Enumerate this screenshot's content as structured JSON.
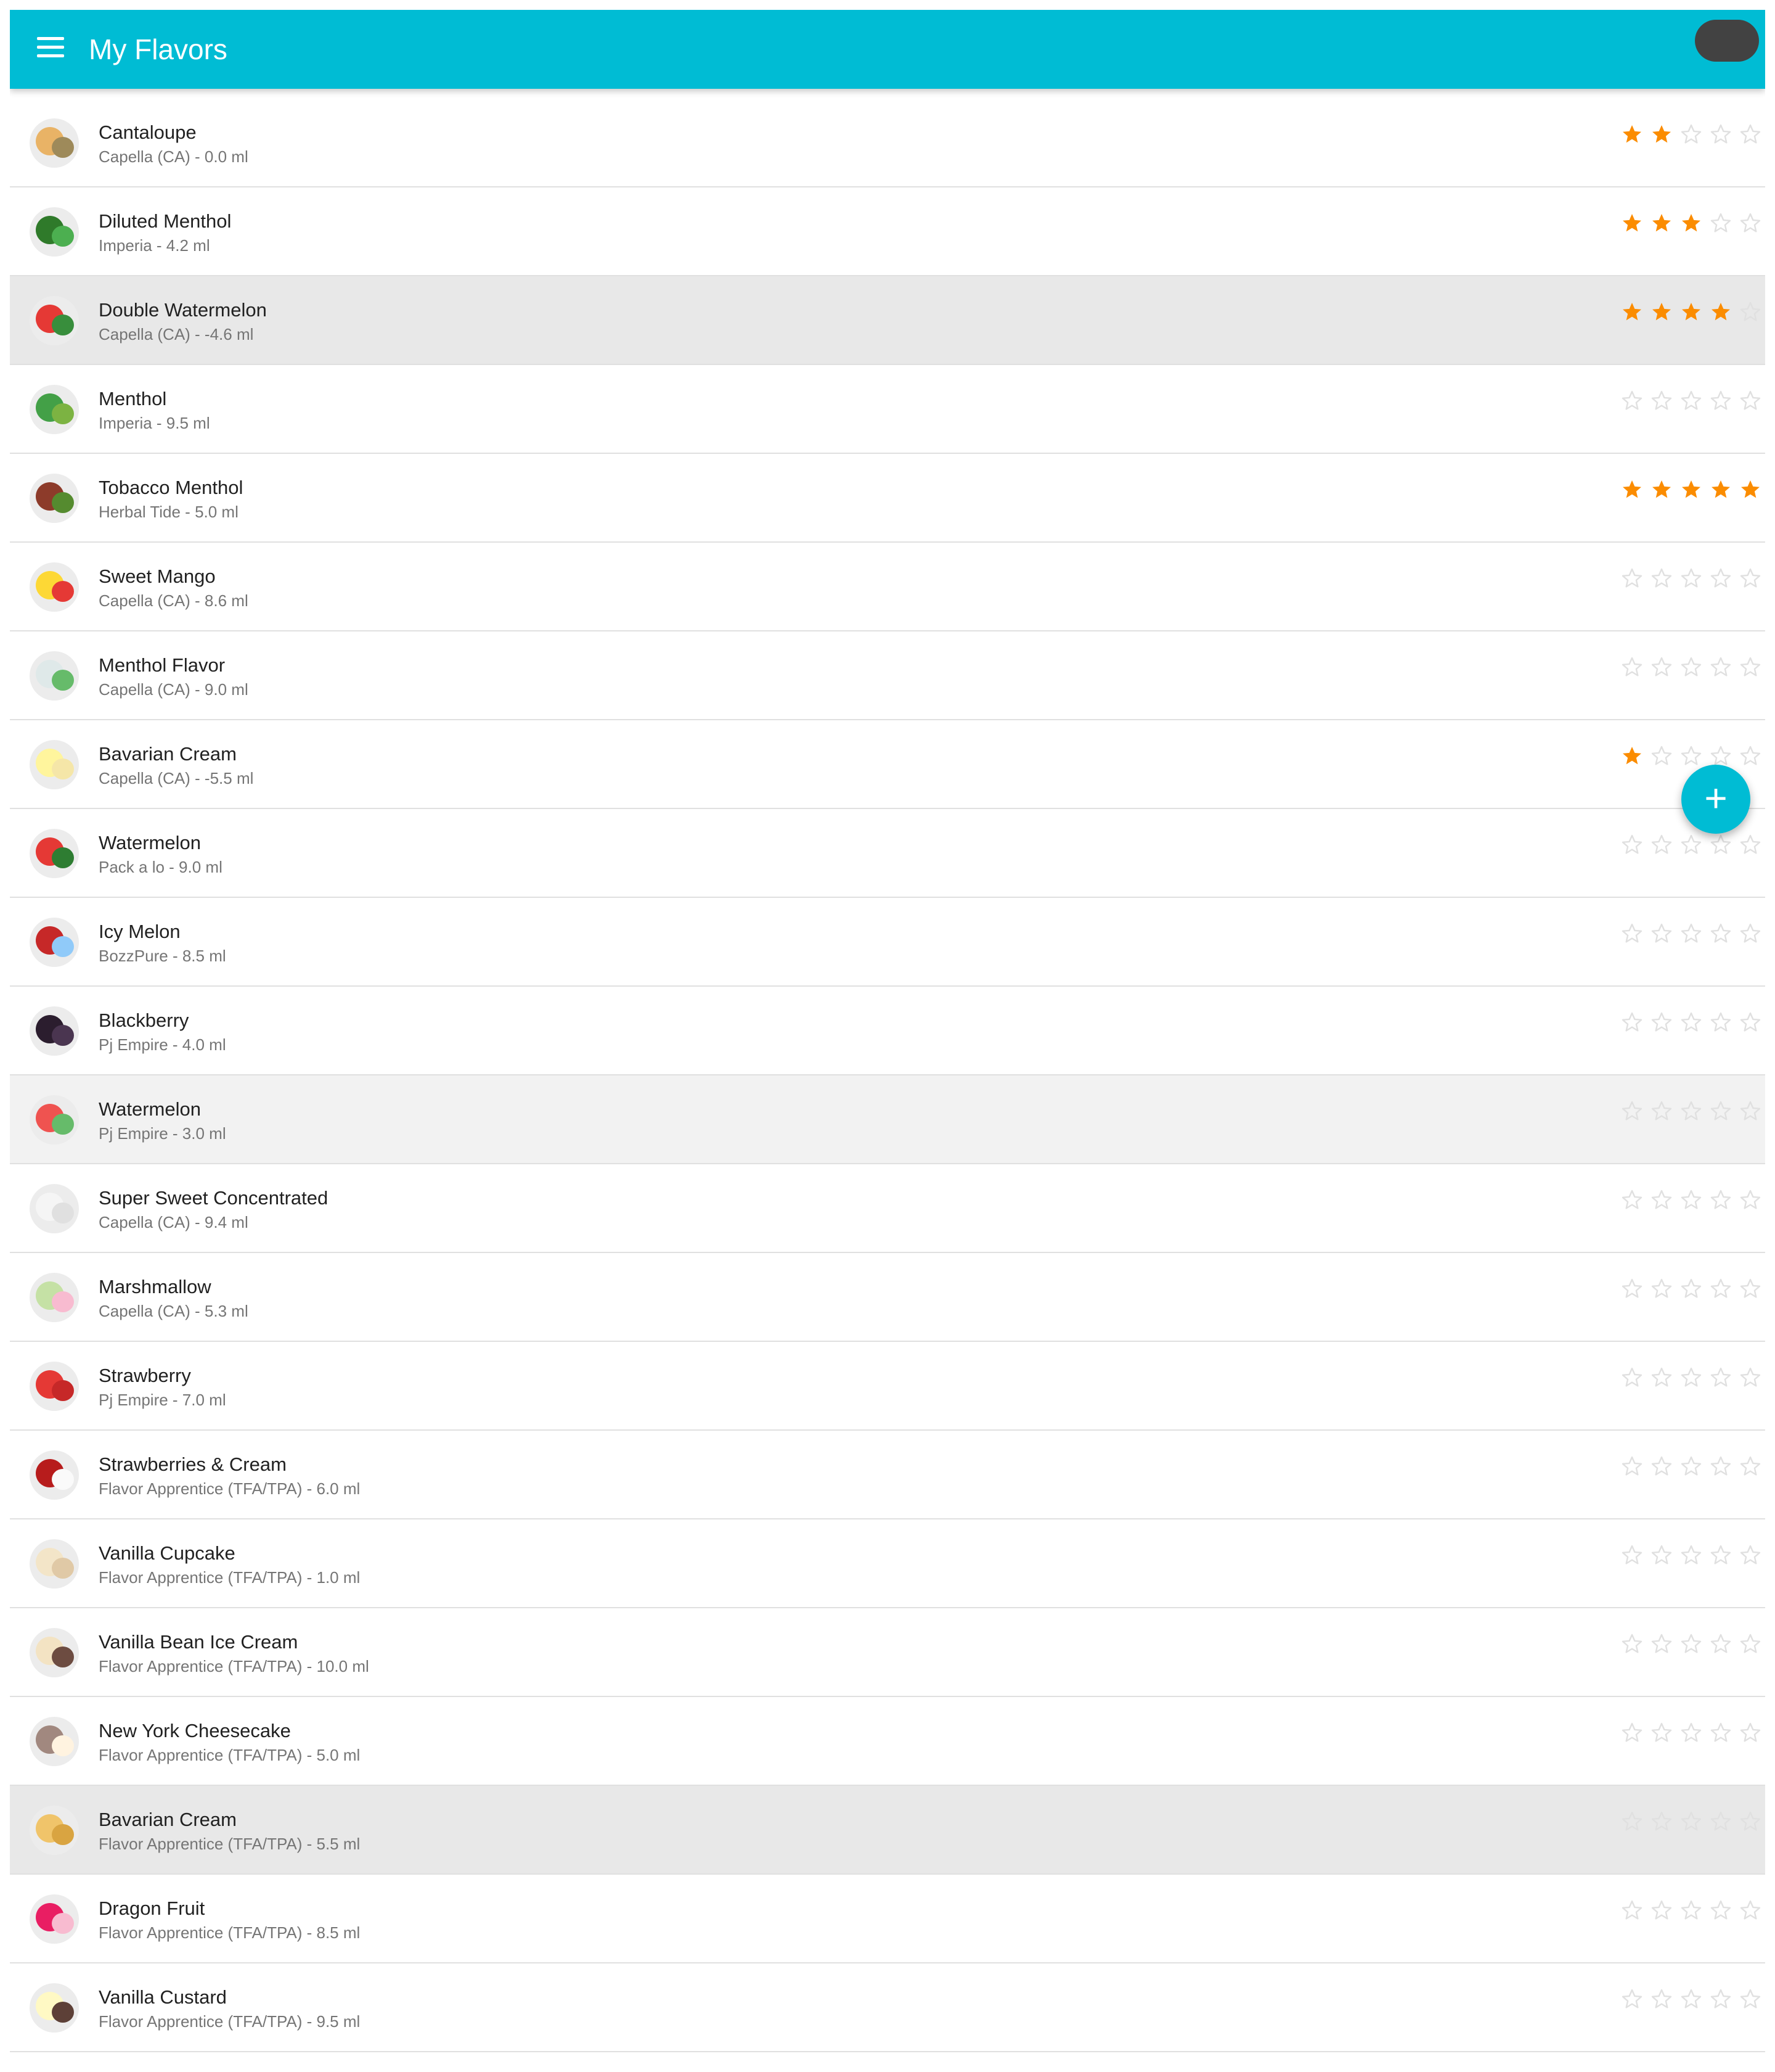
{
  "app": {
    "title": "My Flavors"
  },
  "icons": {
    "menu": "menu-icon",
    "add": "plus-icon",
    "star_filled": "star-filled-icon",
    "star_empty": "star-outline-icon"
  },
  "colors": {
    "appbar": "#00bcd4",
    "star_filled": "#fb8c00",
    "star_empty": "#e0e0e0",
    "fab": "#00bcd4",
    "highlight": "#e8e8e8"
  },
  "fab": {
    "label": "+"
  },
  "flavors": [
    {
      "name": "Cantaloupe",
      "detail": "Capella (CA) - 0.0 ml",
      "rating": 2,
      "thumb": [
        "#e9b366",
        "#9e8a5a"
      ]
    },
    {
      "name": "Diluted Menthol",
      "detail": "Imperia - 4.2 ml",
      "rating": 3,
      "thumb": [
        "#2f7a2a",
        "#4caf50"
      ]
    },
    {
      "name": "Double Watermelon",
      "detail": "Capella (CA) - -4.6 ml",
      "rating": 4,
      "thumb": [
        "#e53935",
        "#388e3c"
      ]
    },
    {
      "name": "Menthol",
      "detail": "Imperia - 9.5 ml",
      "rating": 0,
      "thumb": [
        "#43a047",
        "#7cb342"
      ]
    },
    {
      "name": "Tobacco Menthol",
      "detail": "Herbal Tide - 5.0 ml",
      "rating": 5,
      "thumb": [
        "#8d3b2a",
        "#558b2f"
      ]
    },
    {
      "name": "Sweet Mango",
      "detail": "Capella (CA) - 8.6 ml",
      "rating": 0,
      "thumb": [
        "#fdd835",
        "#e53935"
      ]
    },
    {
      "name": "Menthol Flavor",
      "detail": "Capella (CA) - 9.0 ml",
      "rating": 0,
      "thumb": [
        "#dfe9e9",
        "#66bb6a"
      ]
    },
    {
      "name": "Bavarian Cream",
      "detail": "Capella (CA) - -5.5 ml",
      "rating": 1,
      "thumb": [
        "#fff59d",
        "#f5e6a8"
      ]
    },
    {
      "name": "Watermelon",
      "detail": "Pack a lo - 9.0 ml",
      "rating": 0,
      "thumb": [
        "#e53935",
        "#2e7d32"
      ]
    },
    {
      "name": "Icy Melon",
      "detail": "BozzPure - 8.5 ml",
      "rating": 0,
      "thumb": [
        "#c62828",
        "#90caf9"
      ]
    },
    {
      "name": "Blackberry",
      "detail": "Pj Empire - 4.0 ml",
      "rating": 0,
      "thumb": [
        "#2b1d2e",
        "#4a3550"
      ]
    },
    {
      "name": "Watermelon",
      "detail": "Pj Empire - 3.0 ml",
      "rating": 0,
      "thumb": [
        "#ef5350",
        "#66bb6a"
      ]
    },
    {
      "name": "Super Sweet Concentrated",
      "detail": "Capella (CA) - 9.4 ml",
      "rating": 0,
      "thumb": [
        "#f5f5f5",
        "#e0e0e0"
      ]
    },
    {
      "name": "Marshmallow",
      "detail": "Capella (CA) - 5.3 ml",
      "rating": 0,
      "thumb": [
        "#c5e1a5",
        "#f8bbd0"
      ]
    },
    {
      "name": "Strawberry",
      "detail": "Pj Empire - 7.0 ml",
      "rating": 0,
      "thumb": [
        "#e53935",
        "#c62828"
      ]
    },
    {
      "name": "Strawberries & Cream",
      "detail": "Flavor Apprentice (TFA/TPA) - 6.0 ml",
      "rating": 0,
      "thumb": [
        "#b71c1c",
        "#fafafa"
      ]
    },
    {
      "name": "Vanilla Cupcake",
      "detail": "Flavor Apprentice (TFA/TPA) - 1.0 ml",
      "rating": 0,
      "thumb": [
        "#f3e5c8",
        "#e0c9a6"
      ]
    },
    {
      "name": "Vanilla Bean Ice Cream",
      "detail": "Flavor Apprentice (TFA/TPA) - 10.0 ml",
      "rating": 0,
      "thumb": [
        "#f3e3c3",
        "#6d4c41"
      ]
    },
    {
      "name": "New York Cheesecake",
      "detail": "Flavor Apprentice (TFA/TPA) - 5.0 ml",
      "rating": 0,
      "thumb": [
        "#a1887f",
        "#fff3e0"
      ]
    },
    {
      "name": "Bavarian Cream",
      "detail": "Flavor Apprentice (TFA/TPA) - 5.5 ml",
      "rating": 0,
      "thumb": [
        "#f0c46a",
        "#d9a441"
      ]
    },
    {
      "name": "Dragon Fruit",
      "detail": "Flavor Apprentice (TFA/TPA) - 8.5 ml",
      "rating": 0,
      "thumb": [
        "#e91e63",
        "#f8bbd0"
      ]
    },
    {
      "name": "Vanilla Custard",
      "detail": "Flavor Apprentice (TFA/TPA) - 9.5 ml",
      "rating": 0,
      "thumb": [
        "#fff9c4",
        "#5d4037"
      ]
    }
  ]
}
